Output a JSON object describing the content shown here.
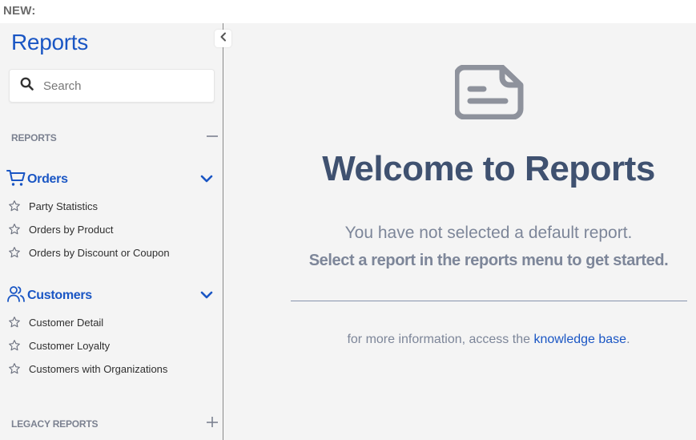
{
  "banner": {
    "label": "NEW:"
  },
  "sidebar": {
    "title": "Reports",
    "collapse_icon": "chevron-left-icon",
    "search": {
      "placeholder": "Search",
      "value": "",
      "icon": "search-icon"
    },
    "sections": [
      {
        "label": "REPORTS",
        "toggle": "—",
        "expanded": true,
        "groups": [
          {
            "label": "Orders",
            "icon": "cart-icon",
            "expanded": true,
            "items": [
              {
                "label": "Party Statistics",
                "favorite": false
              },
              {
                "label": "Orders by Product",
                "favorite": false
              },
              {
                "label": "Orders by Discount or Coupon",
                "favorite": false
              }
            ]
          },
          {
            "label": "Customers",
            "icon": "users-icon",
            "expanded": true,
            "items": [
              {
                "label": "Customer Detail",
                "favorite": false
              },
              {
                "label": "Customer Loyalty",
                "favorite": false
              },
              {
                "label": "Customers with Organizations",
                "favorite": false
              }
            ]
          }
        ]
      },
      {
        "label": "LEGACY REPORTS",
        "toggle": "+",
        "expanded": false
      }
    ]
  },
  "main": {
    "icon": "document-icon",
    "title": "Welcome to Reports",
    "line1": "You have not selected a default report.",
    "line2": "Select a report in the reports menu to get started.",
    "info_prefix": "for more information, access the ",
    "info_link": "knowledge base",
    "info_suffix": "."
  },
  "colors": {
    "accent": "#1a56c4",
    "heading": "#3f5170",
    "muted": "#7d8699",
    "icon_gray": "#8e929c",
    "background": "#f4f4f4"
  }
}
